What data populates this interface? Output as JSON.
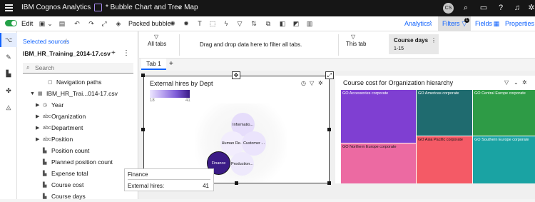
{
  "topbar": {
    "app_name": "IBM Cognos Analytics",
    "doc_title": "* Bubble Chart and Tree Map",
    "avatar_initials": "CS",
    "icons": [
      "search-icon",
      "chat-icon",
      "help-icon",
      "notification-icon",
      "bee-icon"
    ]
  },
  "toolbar": {
    "edit_label": "Edit",
    "viz_type_label": "Packed bubble",
    "analytics_label": "Analytics",
    "filters_label": "Filters",
    "filters_count": "1",
    "fields_label": "Fields",
    "properties_label": "Properties"
  },
  "data_panel": {
    "breadcrumb": "Selected sources",
    "breadcrumb_sep": "/",
    "source_name": "IBM_HR_Training_2014-17.csv",
    "search_placeholder": "Search",
    "tree": [
      {
        "label": "Navigation paths",
        "icon": "folder-icon",
        "level": 1
      },
      {
        "label": "IBM_HR_Trai...014-17.csv",
        "icon": "table-icon",
        "level": 0,
        "expanded": true
      },
      {
        "label": "Year",
        "icon": "clock-icon",
        "level": 1
      },
      {
        "label": "Organization",
        "icon": "abc-icon",
        "level": 1
      },
      {
        "label": "Department",
        "icon": "abc-icon",
        "level": 1
      },
      {
        "label": "Position",
        "icon": "abc-icon",
        "level": 1
      },
      {
        "label": "Position count",
        "icon": "measure-icon",
        "level": 1
      },
      {
        "label": "Planned position count",
        "icon": "measure-icon",
        "level": 1
      },
      {
        "label": "Expense total",
        "icon": "measure-icon",
        "level": 1
      },
      {
        "label": "Course cost",
        "icon": "measure-icon",
        "level": 1
      },
      {
        "label": "Course days",
        "icon": "measure-icon",
        "level": 1
      }
    ]
  },
  "tooltip": {
    "header": "Finance",
    "key": "External hires:",
    "value": "41"
  },
  "filters": {
    "all_tabs_label": "All tabs",
    "drop_hint": "Drag and drop data here to filter all tabs.",
    "this_tab_label": "This tab",
    "chip_title": "Course days",
    "chip_value": "1-15"
  },
  "tabs": [
    {
      "label": "Tab 1"
    }
  ],
  "viz1": {
    "title": "External hires by Dept",
    "legend_min": "18",
    "legend_max": "41",
    "bubbles": [
      "Informatio...",
      "Human Re...",
      "Customer ...",
      "Finance",
      "Production..."
    ]
  },
  "viz2": {
    "title": "Course cost for Organization hierarchy",
    "tiles": [
      {
        "label": "GO Accessories corporate",
        "color": "#7f3fd2"
      },
      {
        "label": "GO Americas corporate",
        "color": "#1f6b6f"
      },
      {
        "label": "GO Central Europe corporate",
        "color": "#2e9b46"
      },
      {
        "label": "GO Northern Europe corporate",
        "color": "#ec6aa2"
      },
      {
        "label": "GO Asia Pacific corporate",
        "color": "#f45a66"
      },
      {
        "label": "GO Southern Europe corporate",
        "color": "#1aa3a3"
      }
    ]
  },
  "colors": {
    "accent": "#0f62fe",
    "bubble_dark": "#3b1b86",
    "bubble_light": "#ede7ff"
  }
}
